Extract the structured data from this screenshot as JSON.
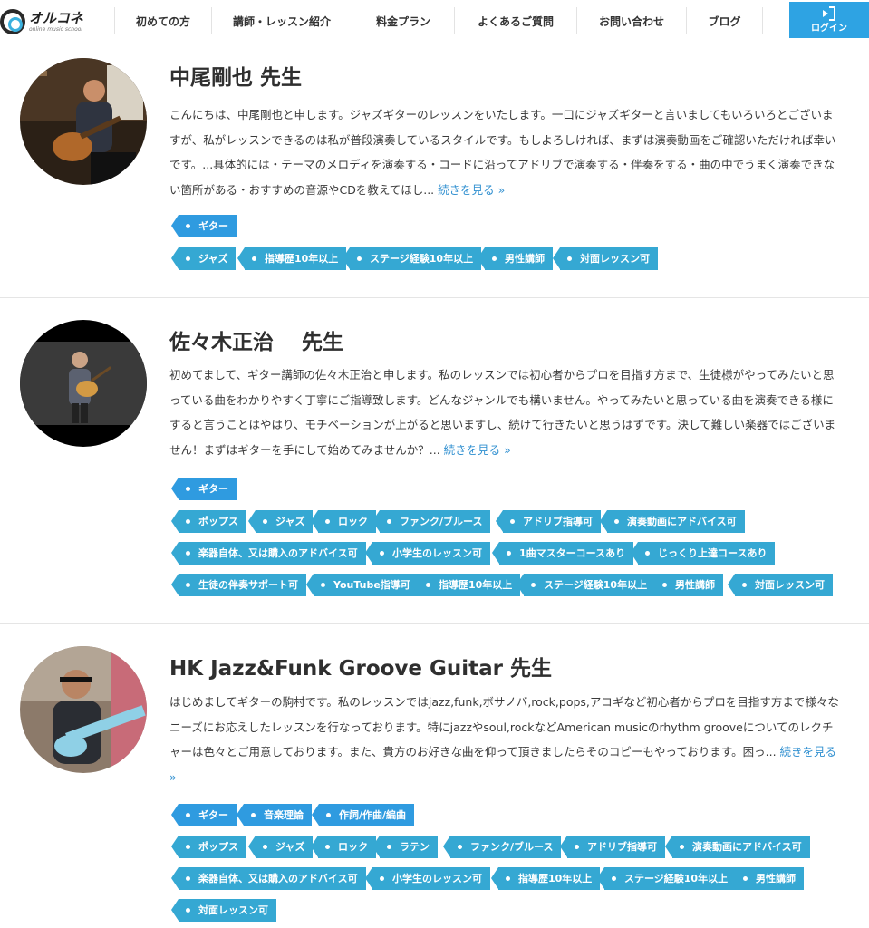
{
  "header": {
    "logo_name": "オルコネ",
    "logo_sub": "online music school",
    "nav": [
      "初めての方",
      "講師・レッスン紹介",
      "料金プラン",
      "よくあるご質問",
      "お問い合わせ",
      "ブログ"
    ],
    "login_label": "ログイン"
  },
  "teachers": [
    {
      "name": "中尾剛也 先生",
      "bio": "こんにちは、中尾剛也と申します。ジャズギターのレッスンをいたします。一口にジャズギターと言いましてもいろいろとございますが、私がレッスンできるのは私が普段演奏しているスタイルです。もしよろしければ、まずは演奏動画をご確認いただければ幸いです。...具体的には・テーマのメロディを演奏する・コードに沿ってアドリブで演奏する・伴奏をする・曲の中でうまく演奏できない箇所がある・おすすめの音源やCDを教えてほし...",
      "more": "続きを見る »",
      "instrument_tags": [
        "ギター"
      ],
      "tags": [
        "ジャズ",
        "指導歴10年以上",
        "ステージ経験10年以上",
        "男性講師",
        "対面レッスン可"
      ]
    },
    {
      "name": "佐々木正治　 先生",
      "bio": "初めてまして、ギター講師の佐々木正治と申します。私のレッスンでは初心者からプロを目指す方まで、生徒様がやってみたいと思っている曲をわかりやすく丁寧にご指導致します。どんなジャンルでも構いません。やってみたいと思っている曲を演奏できる様にすると言うことはやはり、モチベーションが上がると思いますし、続けて行きたいと思うはずです。決して難しい楽器ではございません！まずはギターを手にして始めてみませんか？...",
      "more": "続きを見る »",
      "instrument_tags": [
        "ギター"
      ],
      "tags": [
        "ポップス",
        "ジャズ",
        "ロック",
        "ファンク/ブルース",
        "アドリブ指導可",
        "演奏動画にアドバイス可",
        "楽器自体、又は購入のアドバイス可",
        "小学生のレッスン可",
        "1曲マスターコースあり",
        "じっくり上達コースあり",
        "生徒の伴奏サポート可",
        "YouTube指導可",
        "指導歴10年以上",
        "ステージ経験10年以上",
        "男性講師",
        "対面レッスン可"
      ]
    },
    {
      "name": "HK Jazz&Funk Groove Guitar 先生",
      "bio": "はじめましてギターの駒村です。私のレッスンではjazz,funk,ボサノバ,rock,pops,アコギなど初心者からプロを目指す方まで様々なニーズにお応えしたレッスンを行なっております。特にjazzやsoul,rockなどAmerican musicのrhythm grooveについてのレクチャーは色々とご用意しております。また、貴方のお好きな曲を仰って頂きましたらそのコピーもやっております。困っ...",
      "more": "続きを見る »",
      "instrument_tags": [
        "ギター",
        "音楽理論",
        "作詞/作曲/編曲"
      ],
      "tags": [
        "ポップス",
        "ジャズ",
        "ロック",
        "ラテン",
        "ファンク/ブルース",
        "アドリブ指導可",
        "演奏動画にアドバイス可",
        "楽器自体、又は購入のアドバイス可",
        "小学生のレッスン可",
        "指導歴10年以上",
        "ステージ経験10年以上",
        "男性講師",
        "対面レッスン可"
      ]
    }
  ]
}
